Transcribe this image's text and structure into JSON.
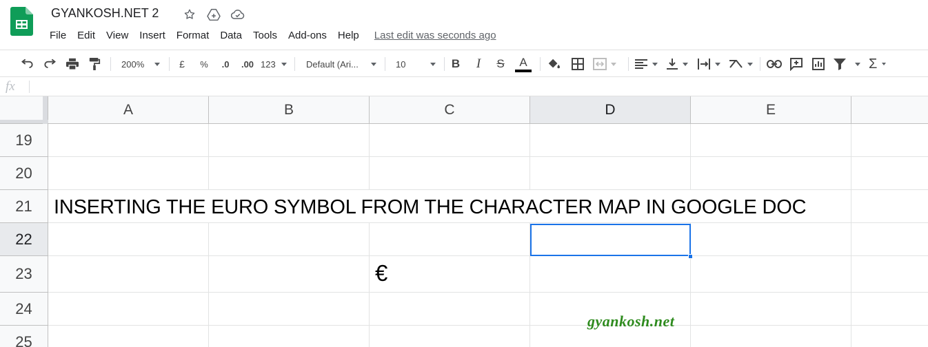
{
  "app": {
    "title": "GYANKOSH.NET 2",
    "accent_color": "#1a73e8",
    "logo_color": "#0f9d58",
    "title_icons": [
      "star-icon",
      "move-to-drive-icon",
      "cloud-status-icon"
    ]
  },
  "menu": {
    "items": [
      "File",
      "Edit",
      "View",
      "Insert",
      "Format",
      "Data",
      "Tools",
      "Add-ons",
      "Help"
    ],
    "last_edit": "Last edit was seconds ago"
  },
  "toolbar": {
    "zoom": "200%",
    "currency": "£",
    "percent": "%",
    "decrease_decimal": ".0",
    "increase_decimal": ".00",
    "more_formats": "123",
    "font": "Default (Ari...",
    "font_size": "10",
    "bold": "B",
    "italic": "I",
    "strikethrough": "S",
    "text_color": "A",
    "sum": "Σ"
  },
  "formula_bar": {
    "fx": "fx",
    "value": ""
  },
  "sheet": {
    "columns": [
      "A",
      "B",
      "C",
      "D",
      "E"
    ],
    "rows": [
      "19",
      "20",
      "21",
      "22",
      "23",
      "24",
      "25"
    ],
    "selected_cell": "D22",
    "cells": {
      "A21": "INSERTING THE EURO SYMBOL FROM THE CHARACTER MAP IN GOOGLE DOC",
      "C23": "€"
    }
  },
  "watermark": "gyankosh.net"
}
